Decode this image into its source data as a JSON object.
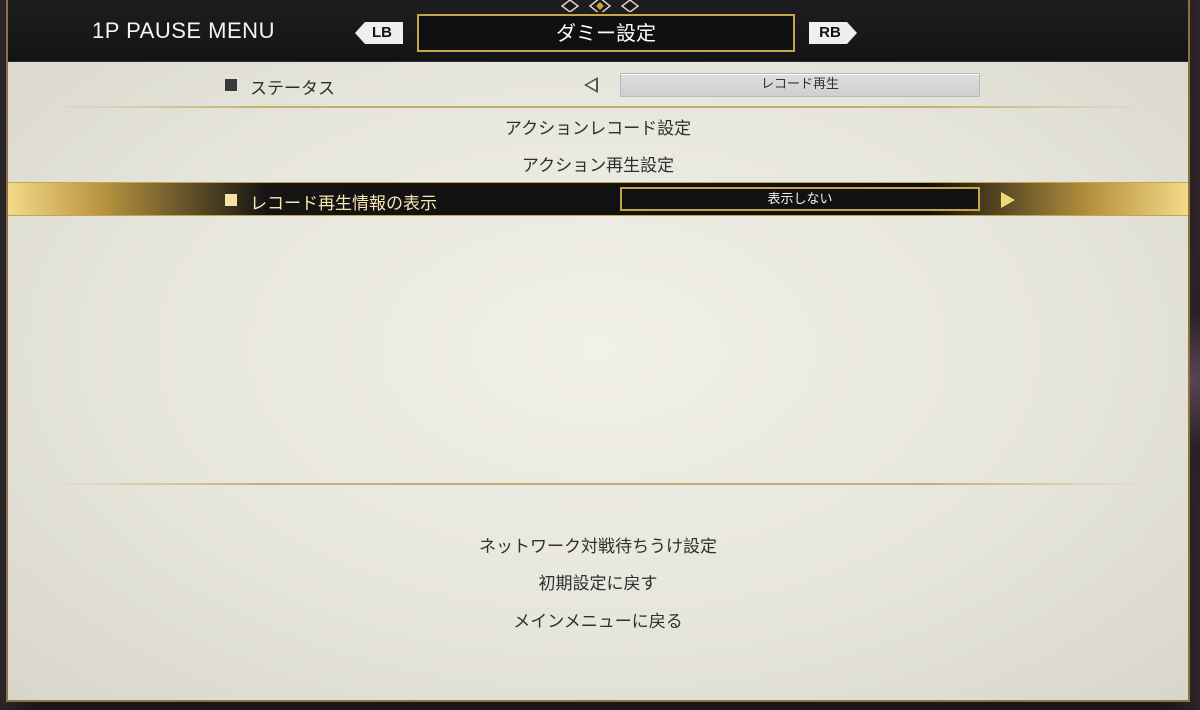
{
  "header": {
    "menu_title": "1P PAUSE MENU",
    "left_bumper": "LB",
    "right_bumper": "RB",
    "active_tab": "ダミー設定"
  },
  "settings": {
    "status": {
      "label": "ステータス",
      "value": "レコード再生"
    },
    "action_record": "アクションレコード設定",
    "action_playback": "アクション再生設定",
    "record_info": {
      "label": "レコード再生情報の表示",
      "value": "表示しない"
    }
  },
  "footer_menu": {
    "network": "ネットワーク対戦待ちうけ設定",
    "reset": "初期設定に戻す",
    "main_menu": "メインメニューに戻る"
  },
  "colors": {
    "accent_gold": "#c8a449",
    "header_bg": "#131316",
    "panel_bg": "#e7e6dc"
  }
}
